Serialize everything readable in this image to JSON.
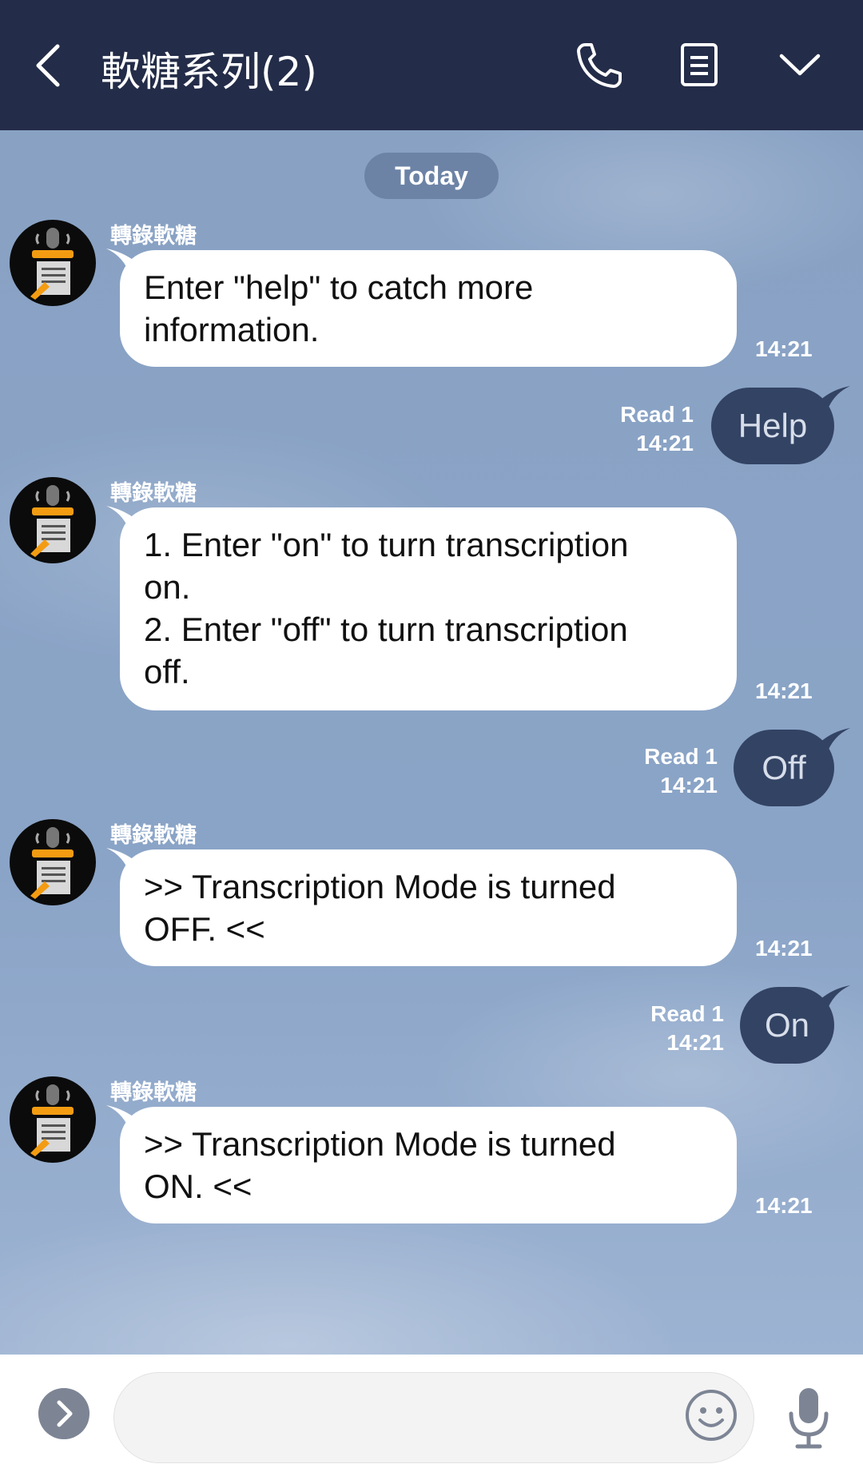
{
  "header": {
    "title": "軟糖系列(2)",
    "icons": [
      "back-arrow-icon",
      "phone-icon",
      "notes-icon",
      "chevron-down-icon"
    ]
  },
  "chat": {
    "date_label": "Today",
    "messages": [
      {
        "direction": "in",
        "sender": "轉錄軟糖",
        "text": "Enter \"help\" to catch more\ninformation.",
        "time": "14:21"
      },
      {
        "direction": "out",
        "text": "Help",
        "read": "Read 1",
        "time": "14:21"
      },
      {
        "direction": "in",
        "sender": "轉錄軟糖",
        "text": "1. Enter \"on\" to turn transcription\non.\n2. Enter \"off\" to turn transcription\noff.",
        "time": "14:21"
      },
      {
        "direction": "out",
        "text": "Off",
        "read": "Read 1",
        "time": "14:21"
      },
      {
        "direction": "in",
        "sender": "轉錄軟糖",
        "text": ">> Transcription Mode is turned\nOFF. <<",
        "time": "14:21"
      },
      {
        "direction": "out",
        "text": "On",
        "read": "Read 1",
        "time": "14:21"
      },
      {
        "direction": "in",
        "sender": "轉錄軟糖",
        "text": ">> Transcription Mode is turned\nON. <<",
        "time": "14:21"
      }
    ]
  },
  "footer": {
    "input_value": "",
    "icons": [
      "expand-icon",
      "emoji-icon",
      "microphone-icon"
    ]
  },
  "colors": {
    "header_bg": "#232c48",
    "chat_bg": "#8aa3c6",
    "outgoing_bubble": "#334364",
    "incoming_bubble": "#ffffff",
    "avatar_accent": "#f39c12"
  }
}
